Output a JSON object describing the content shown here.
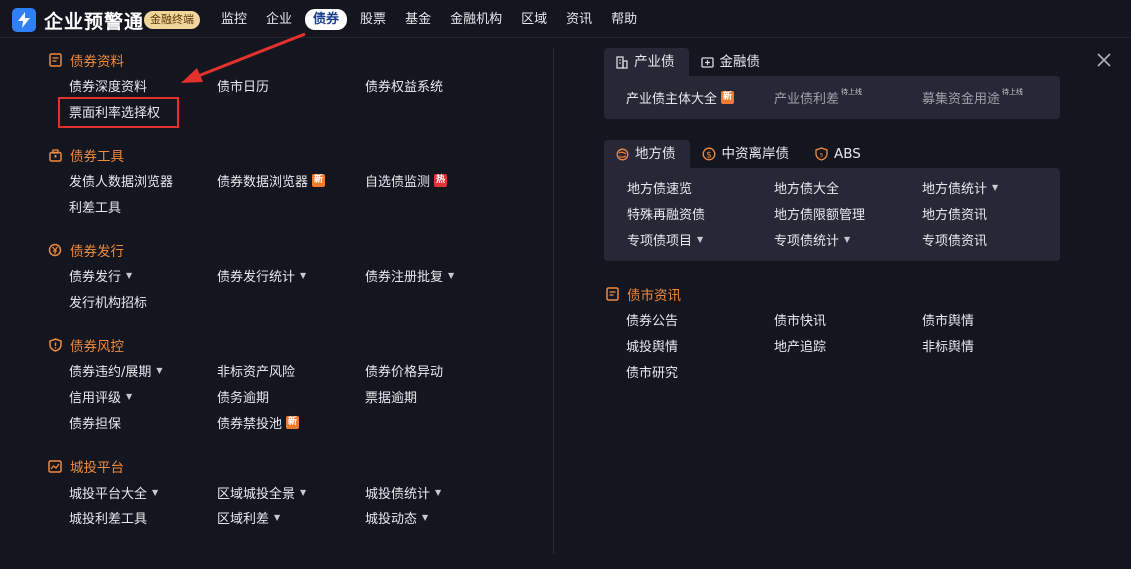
{
  "app": {
    "brand_name": "企业预警通",
    "badge": "金融终端"
  },
  "nav": [
    "监控",
    "企业",
    "债券",
    "股票",
    "基金",
    "金融机构",
    "区域",
    "资讯",
    "帮助"
  ],
  "nav_active": "债券",
  "left": {
    "sections": [
      {
        "title": "债券资料",
        "links": [
          "债券深度资料",
          "债市日历",
          "债券权益系统",
          "票面利率选择权"
        ]
      },
      {
        "title": "债券工具",
        "links": [
          "发债人数据浏览器",
          "债券数据浏览器",
          "自选债监测",
          "利差工具"
        ],
        "tags": {
          "new": "新",
          "hot": "热"
        }
      },
      {
        "title": "债券发行",
        "links": [
          "债券发行",
          "债券发行统计",
          "债券注册批复",
          "发行机构招标"
        ]
      },
      {
        "title": "债券风控",
        "links": [
          "债券违约/展期",
          "非标资产风险",
          "债券价格异动",
          "信用评级",
          "债务逾期",
          "票据逾期",
          "债券担保",
          "债券禁投池"
        ]
      },
      {
        "title": "城投平台",
        "links": [
          "城投平台大全",
          "区域城投全景",
          "城投债统计",
          "城投利差工具",
          "区域利差",
          "城投动态"
        ]
      }
    ]
  },
  "right": {
    "panel1": {
      "tabs": [
        "产业债",
        "金融债"
      ],
      "links": [
        "产业债主体大全",
        "产业债利差",
        "募集资金用途"
      ],
      "sup": "待上线"
    },
    "panel2": {
      "tabs": [
        "地方债",
        "中资离岸债",
        "ABS"
      ],
      "links": [
        "地方债速览",
        "地方债大全",
        "地方债统计",
        "特殊再融资债",
        "地方债限额管理",
        "地方债资讯",
        "专项债项目",
        "专项债统计",
        "专项债资讯"
      ]
    },
    "news": {
      "title": "债市资讯",
      "links": [
        "债券公告",
        "债市快讯",
        "债市舆情",
        "城投舆情",
        "地产追踪",
        "非标舆情",
        "债市研究"
      ]
    }
  },
  "icons": {
    "logo": "lightning-icon",
    "close": "close-icon"
  },
  "colors": {
    "accent_orange": "#f08a3c",
    "highlight_red": "#e3312d",
    "active_nav_text": "#1a3d8f",
    "badge_bg": "#f2d59a"
  }
}
